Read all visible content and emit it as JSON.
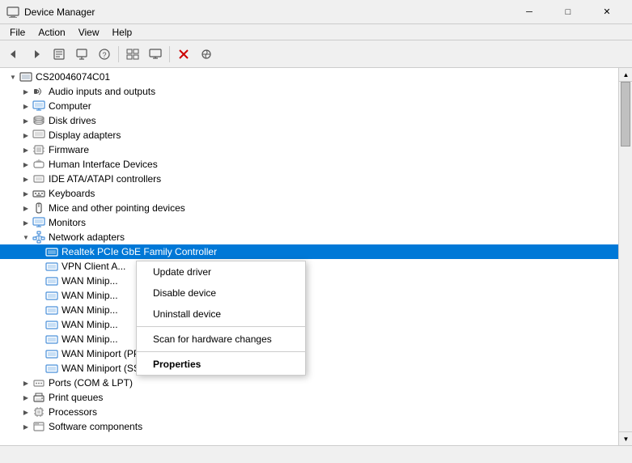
{
  "titleBar": {
    "title": "Device Manager",
    "icon": "💻",
    "buttons": {
      "minimize": "─",
      "maximize": "□",
      "close": "✕"
    }
  },
  "menuBar": {
    "items": [
      "File",
      "Action",
      "View",
      "Help"
    ]
  },
  "toolbar": {
    "buttons": [
      "◀",
      "▶",
      "⚙",
      "⊡",
      "?",
      "▦",
      "🖥",
      "🗑",
      "✕",
      "⬇"
    ]
  },
  "tree": {
    "root": "CS20046074C01",
    "items": [
      {
        "id": "audio",
        "label": "Audio inputs and outputs",
        "indent": 1,
        "expanded": false,
        "icon": "audio"
      },
      {
        "id": "computer",
        "label": "Computer",
        "indent": 1,
        "expanded": false,
        "icon": "computer"
      },
      {
        "id": "disk",
        "label": "Disk drives",
        "indent": 1,
        "expanded": false,
        "icon": "disk"
      },
      {
        "id": "display",
        "label": "Display adapters",
        "indent": 1,
        "expanded": false,
        "icon": "display"
      },
      {
        "id": "firmware",
        "label": "Firmware",
        "indent": 1,
        "expanded": false,
        "icon": "firmware"
      },
      {
        "id": "hid",
        "label": "Human Interface Devices",
        "indent": 1,
        "expanded": false,
        "icon": "hid"
      },
      {
        "id": "ide",
        "label": "IDE ATA/ATAPI controllers",
        "indent": 1,
        "expanded": false,
        "icon": "ide"
      },
      {
        "id": "keyboards",
        "label": "Keyboards",
        "indent": 1,
        "expanded": false,
        "icon": "keyboard"
      },
      {
        "id": "mice",
        "label": "Mice and other pointing devices",
        "indent": 1,
        "expanded": false,
        "icon": "mouse"
      },
      {
        "id": "monitors",
        "label": "Monitors",
        "indent": 1,
        "expanded": false,
        "icon": "monitor"
      },
      {
        "id": "network",
        "label": "Network adapters",
        "indent": 1,
        "expanded": true,
        "icon": "network",
        "highlighted": false
      },
      {
        "id": "realtek",
        "label": "Realtek PCIe GbE Family Controller",
        "indent": 2,
        "expanded": false,
        "icon": "network-card",
        "highlighted": true
      },
      {
        "id": "vpn",
        "label": "VPN Client A...",
        "indent": 2,
        "expanded": false,
        "icon": "network-card"
      },
      {
        "id": "wan1",
        "label": "WAN Minip...",
        "indent": 2,
        "expanded": false,
        "icon": "network-card"
      },
      {
        "id": "wan2",
        "label": "WAN Minip...",
        "indent": 2,
        "expanded": false,
        "icon": "network-card"
      },
      {
        "id": "wan3",
        "label": "WAN Minip...",
        "indent": 2,
        "expanded": false,
        "icon": "network-card"
      },
      {
        "id": "wan4",
        "label": "WAN Minip...",
        "indent": 2,
        "expanded": false,
        "icon": "network-card"
      },
      {
        "id": "wan5",
        "label": "WAN Minip...",
        "indent": 2,
        "expanded": false,
        "icon": "network-card"
      },
      {
        "id": "wan-pptp",
        "label": "WAN Miniport (PPTP)",
        "indent": 2,
        "expanded": false,
        "icon": "network-card"
      },
      {
        "id": "wan-sstp",
        "label": "WAN Miniport (SSTP)",
        "indent": 2,
        "expanded": false,
        "icon": "network-card"
      },
      {
        "id": "ports",
        "label": "Ports (COM & LPT)",
        "indent": 1,
        "expanded": false,
        "icon": "ports"
      },
      {
        "id": "print",
        "label": "Print queues",
        "indent": 1,
        "expanded": false,
        "icon": "print"
      },
      {
        "id": "processors",
        "label": "Processors",
        "indent": 1,
        "expanded": false,
        "icon": "cpu"
      },
      {
        "id": "software",
        "label": "Software components",
        "indent": 1,
        "expanded": false,
        "icon": "software"
      }
    ]
  },
  "contextMenu": {
    "items": [
      {
        "id": "update-driver",
        "label": "Update driver",
        "bold": false
      },
      {
        "id": "disable-device",
        "label": "Disable device",
        "bold": false
      },
      {
        "id": "uninstall-device",
        "label": "Uninstall device",
        "bold": false
      },
      {
        "id": "separator1",
        "type": "separator"
      },
      {
        "id": "scan-hardware",
        "label": "Scan for hardware changes",
        "bold": false
      },
      {
        "id": "separator2",
        "type": "separator"
      },
      {
        "id": "properties",
        "label": "Properties",
        "bold": true
      }
    ]
  },
  "statusBar": {
    "text": ""
  }
}
